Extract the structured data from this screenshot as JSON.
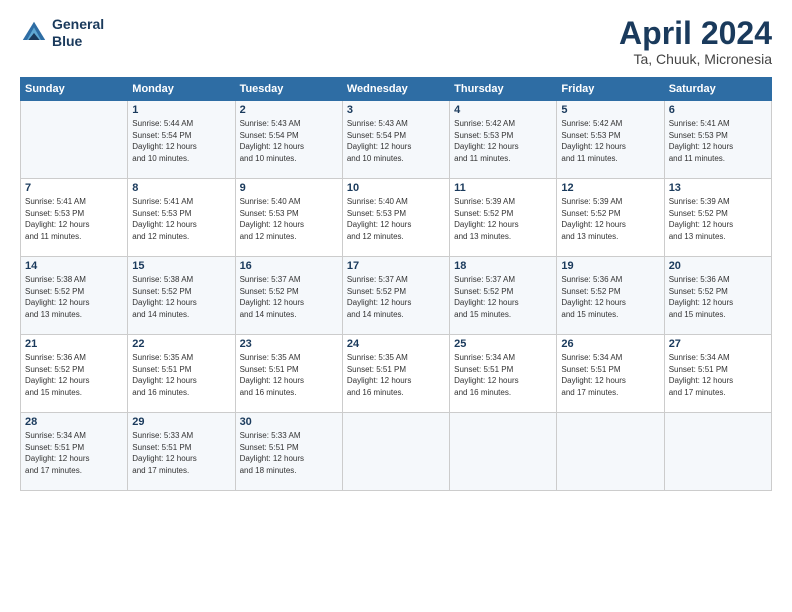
{
  "header": {
    "logo_line1": "General",
    "logo_line2": "Blue",
    "month_title": "April 2024",
    "subtitle": "Ta, Chuuk, Micronesia"
  },
  "days_of_week": [
    "Sunday",
    "Monday",
    "Tuesday",
    "Wednesday",
    "Thursday",
    "Friday",
    "Saturday"
  ],
  "weeks": [
    [
      {
        "day": "",
        "info": ""
      },
      {
        "day": "1",
        "info": "Sunrise: 5:44 AM\nSunset: 5:54 PM\nDaylight: 12 hours\nand 10 minutes."
      },
      {
        "day": "2",
        "info": "Sunrise: 5:43 AM\nSunset: 5:54 PM\nDaylight: 12 hours\nand 10 minutes."
      },
      {
        "day": "3",
        "info": "Sunrise: 5:43 AM\nSunset: 5:54 PM\nDaylight: 12 hours\nand 10 minutes."
      },
      {
        "day": "4",
        "info": "Sunrise: 5:42 AM\nSunset: 5:53 PM\nDaylight: 12 hours\nand 11 minutes."
      },
      {
        "day": "5",
        "info": "Sunrise: 5:42 AM\nSunset: 5:53 PM\nDaylight: 12 hours\nand 11 minutes."
      },
      {
        "day": "6",
        "info": "Sunrise: 5:41 AM\nSunset: 5:53 PM\nDaylight: 12 hours\nand 11 minutes."
      }
    ],
    [
      {
        "day": "7",
        "info": "Sunrise: 5:41 AM\nSunset: 5:53 PM\nDaylight: 12 hours\nand 11 minutes."
      },
      {
        "day": "8",
        "info": "Sunrise: 5:41 AM\nSunset: 5:53 PM\nDaylight: 12 hours\nand 12 minutes."
      },
      {
        "day": "9",
        "info": "Sunrise: 5:40 AM\nSunset: 5:53 PM\nDaylight: 12 hours\nand 12 minutes."
      },
      {
        "day": "10",
        "info": "Sunrise: 5:40 AM\nSunset: 5:53 PM\nDaylight: 12 hours\nand 12 minutes."
      },
      {
        "day": "11",
        "info": "Sunrise: 5:39 AM\nSunset: 5:52 PM\nDaylight: 12 hours\nand 13 minutes."
      },
      {
        "day": "12",
        "info": "Sunrise: 5:39 AM\nSunset: 5:52 PM\nDaylight: 12 hours\nand 13 minutes."
      },
      {
        "day": "13",
        "info": "Sunrise: 5:39 AM\nSunset: 5:52 PM\nDaylight: 12 hours\nand 13 minutes."
      }
    ],
    [
      {
        "day": "14",
        "info": "Sunrise: 5:38 AM\nSunset: 5:52 PM\nDaylight: 12 hours\nand 13 minutes."
      },
      {
        "day": "15",
        "info": "Sunrise: 5:38 AM\nSunset: 5:52 PM\nDaylight: 12 hours\nand 14 minutes."
      },
      {
        "day": "16",
        "info": "Sunrise: 5:37 AM\nSunset: 5:52 PM\nDaylight: 12 hours\nand 14 minutes."
      },
      {
        "day": "17",
        "info": "Sunrise: 5:37 AM\nSunset: 5:52 PM\nDaylight: 12 hours\nand 14 minutes."
      },
      {
        "day": "18",
        "info": "Sunrise: 5:37 AM\nSunset: 5:52 PM\nDaylight: 12 hours\nand 15 minutes."
      },
      {
        "day": "19",
        "info": "Sunrise: 5:36 AM\nSunset: 5:52 PM\nDaylight: 12 hours\nand 15 minutes."
      },
      {
        "day": "20",
        "info": "Sunrise: 5:36 AM\nSunset: 5:52 PM\nDaylight: 12 hours\nand 15 minutes."
      }
    ],
    [
      {
        "day": "21",
        "info": "Sunrise: 5:36 AM\nSunset: 5:52 PM\nDaylight: 12 hours\nand 15 minutes."
      },
      {
        "day": "22",
        "info": "Sunrise: 5:35 AM\nSunset: 5:51 PM\nDaylight: 12 hours\nand 16 minutes."
      },
      {
        "day": "23",
        "info": "Sunrise: 5:35 AM\nSunset: 5:51 PM\nDaylight: 12 hours\nand 16 minutes."
      },
      {
        "day": "24",
        "info": "Sunrise: 5:35 AM\nSunset: 5:51 PM\nDaylight: 12 hours\nand 16 minutes."
      },
      {
        "day": "25",
        "info": "Sunrise: 5:34 AM\nSunset: 5:51 PM\nDaylight: 12 hours\nand 16 minutes."
      },
      {
        "day": "26",
        "info": "Sunrise: 5:34 AM\nSunset: 5:51 PM\nDaylight: 12 hours\nand 17 minutes."
      },
      {
        "day": "27",
        "info": "Sunrise: 5:34 AM\nSunset: 5:51 PM\nDaylight: 12 hours\nand 17 minutes."
      }
    ],
    [
      {
        "day": "28",
        "info": "Sunrise: 5:34 AM\nSunset: 5:51 PM\nDaylight: 12 hours\nand 17 minutes."
      },
      {
        "day": "29",
        "info": "Sunrise: 5:33 AM\nSunset: 5:51 PM\nDaylight: 12 hours\nand 17 minutes."
      },
      {
        "day": "30",
        "info": "Sunrise: 5:33 AM\nSunset: 5:51 PM\nDaylight: 12 hours\nand 18 minutes."
      },
      {
        "day": "",
        "info": ""
      },
      {
        "day": "",
        "info": ""
      },
      {
        "day": "",
        "info": ""
      },
      {
        "day": "",
        "info": ""
      }
    ]
  ]
}
